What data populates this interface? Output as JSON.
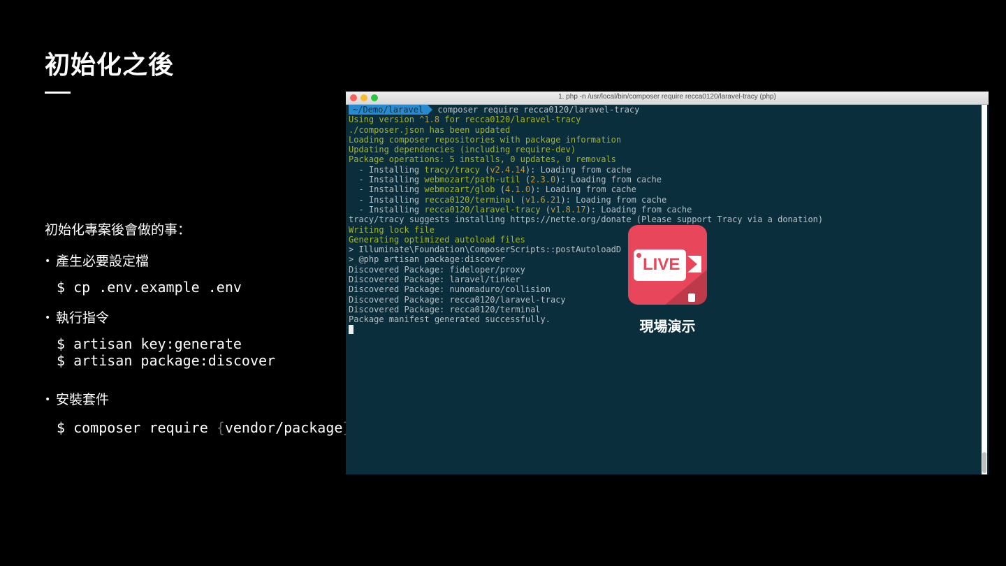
{
  "slide": {
    "title": "初始化之後",
    "intro": "初始化專案後會做的事：",
    "bullets": [
      {
        "marker": "•",
        "label": "產生必要設定檔",
        "commands": [
          "$ cp .env.example .env"
        ]
      },
      {
        "marker": "•",
        "label": "執行指令",
        "commands": [
          "$ artisan key:generate",
          "$ artisan package:discover"
        ]
      },
      {
        "marker": "•",
        "label": "安裝套件",
        "command_prefix": "$ composer require ",
        "brace_open": "{",
        "command_arg": "vendor/package",
        "brace_close": "}"
      }
    ]
  },
  "terminal": {
    "window_title": "1. php -n /usr/local/bin/composer require recca0120/laravel-tracy (php)",
    "prompt_path": "~/Demo/laravel",
    "prompt_command": "composer require recca0120/laravel-tracy",
    "lines": [
      {
        "segs": [
          {
            "t": "Using version ",
            "c": "green"
          },
          {
            "t": "^1.8",
            "c": "yellow"
          },
          {
            "t": " for recca0120/laravel-tracy",
            "c": "green"
          }
        ]
      },
      {
        "segs": [
          {
            "t": "./composer.json has been updated",
            "c": "green"
          }
        ]
      },
      {
        "segs": [
          {
            "t": "Loading composer repositories with package information",
            "c": "green"
          }
        ]
      },
      {
        "segs": [
          {
            "t": "Updating dependencies (including require-dev)",
            "c": "green"
          }
        ]
      },
      {
        "segs": [
          {
            "t": "Package operations: 5 installs, 0 updates, 0 removals",
            "c": "green"
          }
        ]
      },
      {
        "segs": [
          {
            "t": "  - Installing ",
            "c": "gray"
          },
          {
            "t": "tracy/tracy",
            "c": "green"
          },
          {
            "t": " (",
            "c": "gray"
          },
          {
            "t": "v2.4.14",
            "c": "yellow"
          },
          {
            "t": "): Loading from cache",
            "c": "gray"
          }
        ]
      },
      {
        "segs": [
          {
            "t": "  - Installing ",
            "c": "gray"
          },
          {
            "t": "webmozart/path-util",
            "c": "green"
          },
          {
            "t": " (",
            "c": "gray"
          },
          {
            "t": "2.3.0",
            "c": "yellow"
          },
          {
            "t": "): Loading from cache",
            "c": "gray"
          }
        ]
      },
      {
        "segs": [
          {
            "t": "  - Installing ",
            "c": "gray"
          },
          {
            "t": "webmozart/glob",
            "c": "green"
          },
          {
            "t": " (",
            "c": "gray"
          },
          {
            "t": "4.1.0",
            "c": "yellow"
          },
          {
            "t": "): Loading from cache",
            "c": "gray"
          }
        ]
      },
      {
        "segs": [
          {
            "t": "  - Installing ",
            "c": "gray"
          },
          {
            "t": "recca0120/terminal",
            "c": "green"
          },
          {
            "t": " (",
            "c": "gray"
          },
          {
            "t": "v1.6.21",
            "c": "yellow"
          },
          {
            "t": "): Loading from cache",
            "c": "gray"
          }
        ]
      },
      {
        "segs": [
          {
            "t": "  - Installing ",
            "c": "gray"
          },
          {
            "t": "recca0120/laravel-tracy",
            "c": "green"
          },
          {
            "t": " (",
            "c": "gray"
          },
          {
            "t": "v1.8.17",
            "c": "yellow"
          },
          {
            "t": "): Loading from cache",
            "c": "gray"
          }
        ]
      },
      {
        "segs": [
          {
            "t": "tracy/tracy suggests installing https://nette.org/donate (Please support Tracy via a donation)",
            "c": "gray"
          }
        ]
      },
      {
        "segs": [
          {
            "t": "Writing lock file",
            "c": "green"
          }
        ]
      },
      {
        "segs": [
          {
            "t": "Generating optimized autoload files",
            "c": "green"
          }
        ]
      },
      {
        "segs": [
          {
            "t": "> Illuminate\\Foundation\\ComposerScripts::postAutoloadD",
            "c": "gray"
          }
        ]
      },
      {
        "segs": [
          {
            "t": "> @php artisan package:discover",
            "c": "gray"
          }
        ]
      },
      {
        "segs": [
          {
            "t": "Discovered Package: fideloper/proxy",
            "c": "gray"
          }
        ]
      },
      {
        "segs": [
          {
            "t": "Discovered Package: laravel/tinker",
            "c": "gray"
          }
        ]
      },
      {
        "segs": [
          {
            "t": "Discovered Package: nunomaduro/collision",
            "c": "gray"
          }
        ]
      },
      {
        "segs": [
          {
            "t": "Discovered Package: recca0120/laravel-tracy",
            "c": "gray"
          }
        ]
      },
      {
        "segs": [
          {
            "t": "Discovered Package: recca0120/terminal",
            "c": "gray"
          }
        ]
      },
      {
        "segs": [
          {
            "t": "Package manifest generated successfully.",
            "c": "gray"
          }
        ]
      }
    ]
  },
  "live_badge": {
    "text": "LIVE",
    "caption": "現場演示"
  }
}
